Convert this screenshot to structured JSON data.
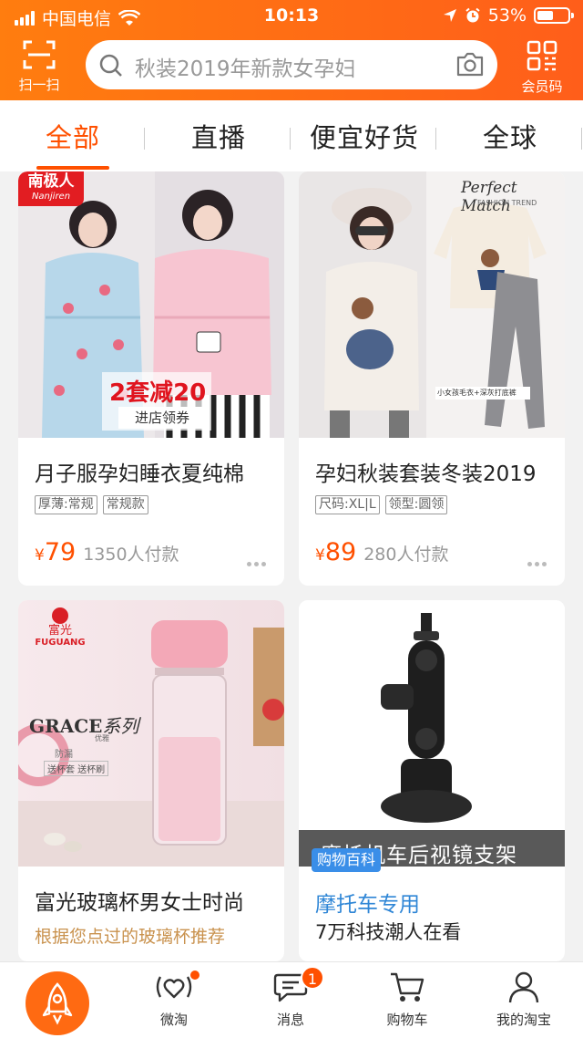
{
  "status_bar": {
    "carrier": "中国电信",
    "time": "10:13",
    "battery": "53%",
    "battery_level": 0.53
  },
  "header": {
    "scan_label": "扫一扫",
    "search_placeholder": "秋装2019年新款女孕妇",
    "member_label": "会员码"
  },
  "tabs": [
    {
      "label": "全部",
      "active": true
    },
    {
      "label": "直播",
      "active": false
    },
    {
      "label": "便宜好货",
      "active": false
    },
    {
      "label": "全球",
      "active": false
    }
  ],
  "products": [
    {
      "brand": "南极人",
      "brand_en": "Nanjiren",
      "promo": "2套减20",
      "promo_sub": "进店领券",
      "title": "月子服孕妇睡衣夏纯棉",
      "tags": [
        "厚薄:常规",
        "常规款"
      ],
      "currency": "¥",
      "price": "79",
      "sold": "1350人付款"
    },
    {
      "image_caption": "Perfect Match",
      "image_sub": "FASHION TREND",
      "image_note": "小女孩毛衣+深灰打底裤",
      "title": "孕妇秋装套装冬装2019",
      "tags": [
        "尺码:XL|L",
        "领型:圆领"
      ],
      "currency": "¥",
      "price": "89",
      "sold": "280人付款"
    },
    {
      "brand": "富光",
      "brand_en": "FUGUANG",
      "series_en": "GRACE",
      "series_cn": "系列",
      "series_small": "优雅",
      "feature_1": "防漏",
      "feature_2": "送杯套 送杯刷",
      "title": "富光玻璃杯男女士时尚",
      "subtitle": "根据您点过的玻璃杯推荐"
    },
    {
      "overlay": "摩托机车后视镜支架",
      "badge": "购物百科",
      "title": "摩托车专用",
      "subtitle": "7万科技潮人在看"
    }
  ],
  "bottom_nav": [
    {
      "label": "",
      "icon": "rocket-icon"
    },
    {
      "label": "微淘",
      "icon": "heart-broadcast-icon",
      "dot": true
    },
    {
      "label": "消息",
      "icon": "chat-bubble-icon",
      "badge": "1"
    },
    {
      "label": "购物车",
      "icon": "cart-icon"
    },
    {
      "label": "我的淘宝",
      "icon": "user-icon"
    }
  ],
  "colors": {
    "brand_orange": "#ff5000",
    "header_start": "#ff7d0f",
    "header_end": "#ff5e1a",
    "link_blue": "#2f86d6"
  }
}
